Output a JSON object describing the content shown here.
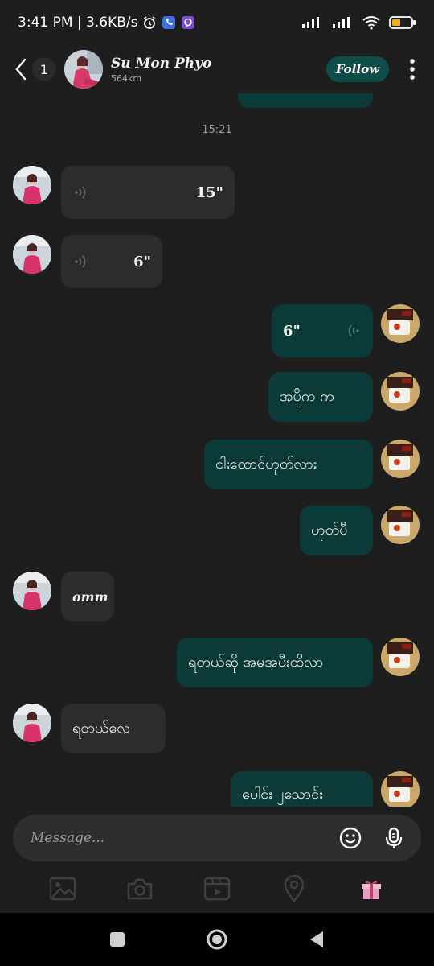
{
  "status_bar": {
    "time_info": "3:41 PM | 3.6KB/s",
    "icons": [
      "alarm-icon",
      "phone-app-icon",
      "viber-icon",
      "signal-icon",
      "signal-icon",
      "wifi-icon",
      "battery-icon"
    ]
  },
  "header": {
    "back_icon": "chevron-left-icon",
    "unread_count": "1",
    "name": "Su Mon Phyo",
    "distance": "564km",
    "follow_label": "Follow",
    "more_icon": "vertical-dots-icon"
  },
  "chat": {
    "timestamp": "15:21",
    "messages": [
      {
        "from": "her",
        "type": "voice",
        "duration": "15\""
      },
      {
        "from": "her",
        "type": "voice",
        "duration": "6\""
      },
      {
        "from": "me",
        "type": "voice",
        "duration": "6\""
      },
      {
        "from": "me",
        "type": "text",
        "text": "အပိုက က"
      },
      {
        "from": "me",
        "type": "text",
        "text": "ငါးထောင်ဟုတ်လား"
      },
      {
        "from": "me",
        "type": "text",
        "text": "ဟုတ်ပီ"
      },
      {
        "from": "her",
        "type": "text",
        "text": "omm"
      },
      {
        "from": "me",
        "type": "text",
        "text": "ရတယ်ဆို အမအပီးထိလာ"
      },
      {
        "from": "her",
        "type": "text",
        "text": "ရတယ်လေ"
      },
      {
        "from": "me",
        "type": "text",
        "text": "ပေါင်း ၂သောင်း"
      }
    ]
  },
  "composer": {
    "placeholder": "Message...",
    "emoji_icon": "emoji-icon",
    "mic_icon": "microphone-icon"
  },
  "tools": [
    "image-icon",
    "camera-icon",
    "video-icon",
    "location-icon",
    "gift-icon"
  ],
  "nav": [
    "square-icon",
    "circle-icon",
    "triangle-back-icon"
  ],
  "colors": {
    "background": "#1e1e1e",
    "incoming_bubble": "#2c2c2e",
    "outgoing_bubble": "#0b3b39",
    "follow_button": "#0f4d4a",
    "gift_accent": "#f0b8d0"
  }
}
